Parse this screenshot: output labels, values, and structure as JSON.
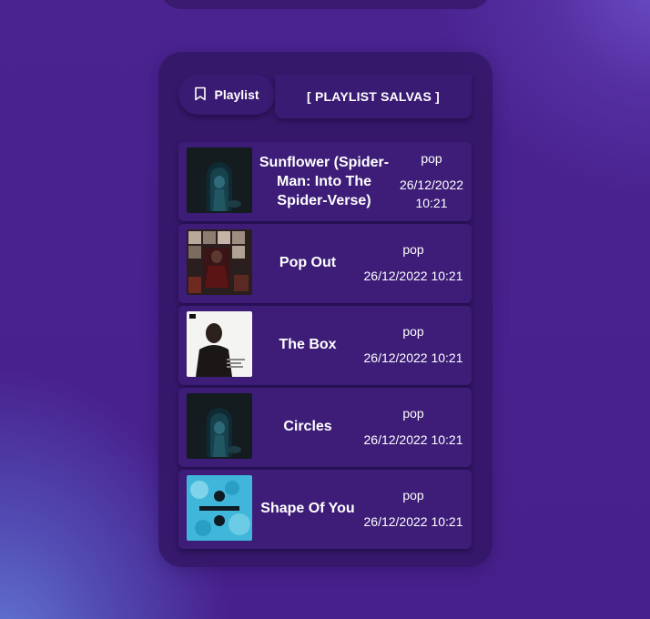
{
  "tabs": {
    "playlist_label": "Playlist",
    "saved_label": "[ PLAYLIST SALVAS ]"
  },
  "tracks": [
    {
      "title": "Sunflower (Spider-Man: Into The Spider-Verse)",
      "genre": "pop",
      "date": "26/12/2022 10:21",
      "cover_icon": "post-malone-hollywoods-bleeding-cover"
    },
    {
      "title": "Pop Out",
      "genre": "pop",
      "date": "26/12/2022 10:21",
      "cover_icon": "polo-g-album-cover"
    },
    {
      "title": "The Box",
      "genre": "pop",
      "date": "26/12/2022 10:21",
      "cover_icon": "roddy-ricch-album-cover"
    },
    {
      "title": "Circles",
      "genre": "pop",
      "date": "26/12/2022 10:21",
      "cover_icon": "post-malone-hollywoods-bleeding-cover"
    },
    {
      "title": "Shape Of You",
      "genre": "pop",
      "date": "26/12/2022 10:21",
      "cover_icon": "ed-sheeran-divide-cover"
    }
  ],
  "colors": {
    "panel": "#34186a",
    "row": "#3d1d77",
    "accent_blue": "#5f7ad6"
  }
}
